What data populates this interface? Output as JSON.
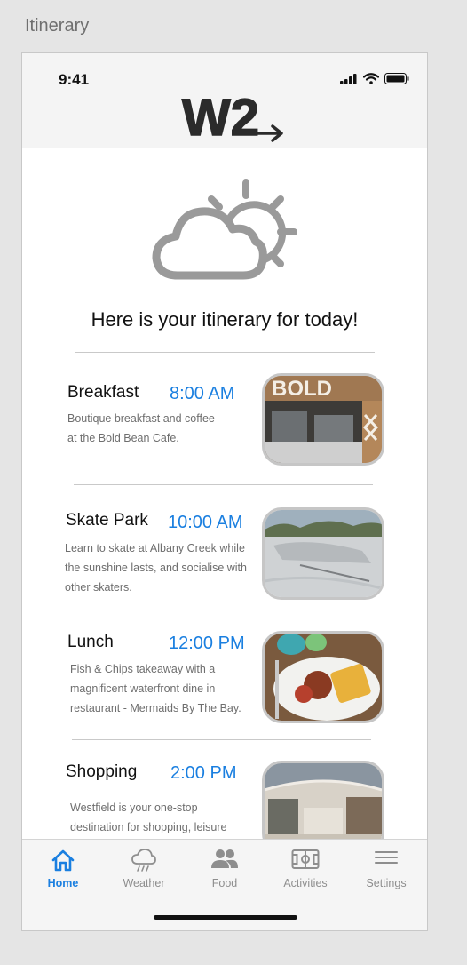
{
  "frame": {
    "label": "Itinerary"
  },
  "status_bar": {
    "time": "9:41"
  },
  "header": {
    "logo_text": "W2"
  },
  "main": {
    "title": "Here is your itinerary for today!",
    "items": [
      {
        "name": "Breakfast",
        "time": "8:00 AM",
        "desc_lines": [
          "Boutique breakfast and coffee",
          "at the Bold Bean Cafe."
        ],
        "image_sign": "BOLD"
      },
      {
        "name": "Skate Park",
        "time": "10:00 AM",
        "desc_lines": [
          "Learn to skate at Albany Creek while",
          "the sunshine lasts, and socialise with",
          "other skaters."
        ]
      },
      {
        "name": "Lunch",
        "time": "12:00 PM",
        "desc_lines": [
          "Fish & Chips takeaway with a",
          "magnificent waterfront dine in",
          "restaurant - Mermaids By The Bay."
        ]
      },
      {
        "name": "Shopping",
        "time": "2:00 PM",
        "desc_lines": [
          "Westfield is your one-stop",
          "destination for shopping, leisure"
        ]
      }
    ]
  },
  "tabbar": {
    "tabs": [
      {
        "label": "Home",
        "icon": "home-icon",
        "active": true
      },
      {
        "label": "Weather",
        "icon": "cloud-rain-icon",
        "active": false
      },
      {
        "label": "Food",
        "icon": "people-icon",
        "active": false
      },
      {
        "label": "Activities",
        "icon": "field-icon",
        "active": false
      },
      {
        "label": "Settings",
        "icon": "menu-icon",
        "active": false
      }
    ]
  },
  "colors": {
    "accent": "#1a7fe0",
    "text": "#111111",
    "muted": "#6e6e6e",
    "inactive_tab": "#8e8e8e"
  }
}
